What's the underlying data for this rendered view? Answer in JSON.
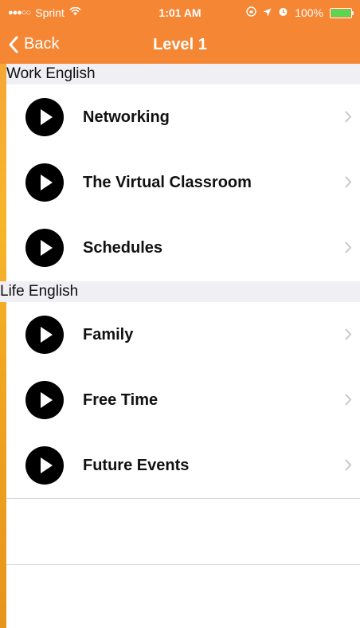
{
  "status_bar": {
    "carrier": "Sprint",
    "time": "1:01 AM",
    "battery": "100%"
  },
  "nav": {
    "back_label": "Back",
    "title": "Level 1"
  },
  "sections": [
    {
      "title": "Work English",
      "items": [
        "Networking",
        "The Virtual Classroom",
        "Schedules"
      ]
    },
    {
      "title": "Life English",
      "items": [
        "Family",
        "Free Time",
        "Future Events"
      ]
    }
  ],
  "colors": {
    "nav_background": "#f58634",
    "battery_fill": "#5ad64f"
  }
}
